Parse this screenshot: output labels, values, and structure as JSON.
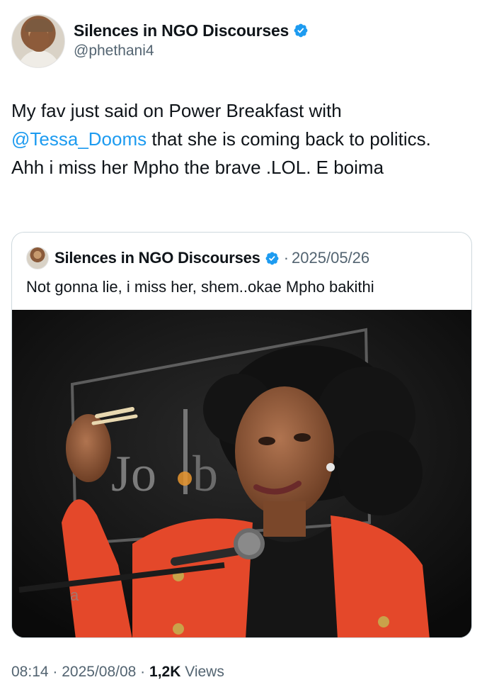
{
  "author": {
    "display_name": "Silences in NGO Discourses",
    "handle": "@phethani4",
    "avatar_icon": "profile-photo"
  },
  "tweet": {
    "text_before": "My fav just said on Power Breakfast with ",
    "mention": "@Tessa_Dooms",
    "text_after": " that she is coming back to politics. Ahh i miss her Mpho the brave .LOL. E boima"
  },
  "quoted_tweet": {
    "display_name": "Silences in NGO Discourses",
    "separator": "·",
    "date": "2025/05/26",
    "text": "Not gonna lie, i miss her, shem..okae Mpho bakithi"
  },
  "footer": {
    "time": "08:14",
    "sep1": " · ",
    "date": "2025/08/08",
    "sep2": " · ",
    "views_count": "1,2K",
    "views_label": " Views"
  },
  "colors": {
    "link": "#1d9bf0",
    "verified": "#1d9bf0",
    "secondary_text": "#536471",
    "primary_text": "#0f1419",
    "border": "#cfd9de"
  }
}
